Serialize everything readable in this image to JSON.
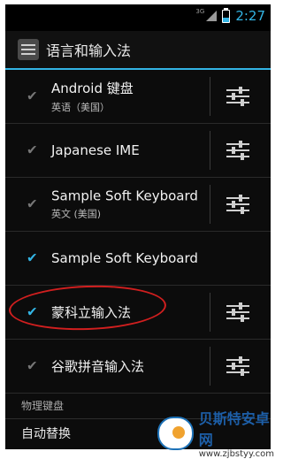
{
  "status": {
    "network": "3G",
    "time": "2:27"
  },
  "header": {
    "title": "语言和输入法"
  },
  "keyboards": [
    {
      "name": "Android 键盘",
      "subtitle": "英语（美国）",
      "checked": true,
      "settings": true,
      "disabled": true
    },
    {
      "name": "Japanese IME",
      "subtitle": "",
      "checked": true,
      "settings": true,
      "disabled": true
    },
    {
      "name": "Sample Soft Keyboard",
      "subtitle": "英文 (美国)",
      "checked": true,
      "settings": true,
      "disabled": true
    },
    {
      "name": "Sample Soft Keyboard",
      "subtitle": "",
      "checked": true,
      "settings": false,
      "disabled": false
    },
    {
      "name": "蒙科立输入法",
      "subtitle": "",
      "checked": true,
      "settings": true,
      "disabled": false
    },
    {
      "name": "谷歌拼音输入法",
      "subtitle": "",
      "checked": true,
      "settings": true,
      "disabled": true
    }
  ],
  "section": {
    "physical_keyboard": "物理键盘"
  },
  "bottom_item": {
    "label": "自动替换"
  },
  "watermark": {
    "name": "贝斯特安卓网",
    "url": "www.zjbstyy.com"
  },
  "colors": {
    "accent": "#33b5e5",
    "highlight_circle": "#d11f1f"
  }
}
